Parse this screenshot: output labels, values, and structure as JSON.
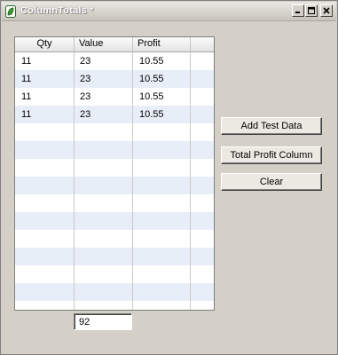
{
  "window": {
    "title": "ColumnTotals *",
    "minimize_label": "_",
    "maximize_label": "□",
    "close_label": "×"
  },
  "table": {
    "columns": [
      "Qty",
      "Value",
      "Profit",
      ""
    ],
    "rows": [
      [
        "11",
        "23",
        "10.55"
      ],
      [
        "11",
        "23",
        "10.55"
      ],
      [
        "11",
        "23",
        "10.55"
      ],
      [
        "11",
        "23",
        "10.55"
      ],
      [
        "",
        "",
        ""
      ],
      [
        "",
        "",
        ""
      ],
      [
        "",
        "",
        ""
      ],
      [
        "",
        "",
        ""
      ],
      [
        "",
        "",
        ""
      ],
      [
        "",
        "",
        ""
      ],
      [
        "",
        "",
        ""
      ],
      [
        "",
        "",
        ""
      ],
      [
        "",
        "",
        ""
      ],
      [
        "",
        "",
        ""
      ],
      [
        "",
        "",
        ""
      ]
    ]
  },
  "buttons": {
    "add_test_data": "Add Test Data",
    "total_profit_column": "Total Profit Column",
    "clear": "Clear"
  },
  "total_field": {
    "value": "92"
  },
  "icons": {
    "app": "leaf-icon",
    "minimize": "minimize-icon",
    "maximize": "maximize-icon",
    "close": "close-icon"
  }
}
